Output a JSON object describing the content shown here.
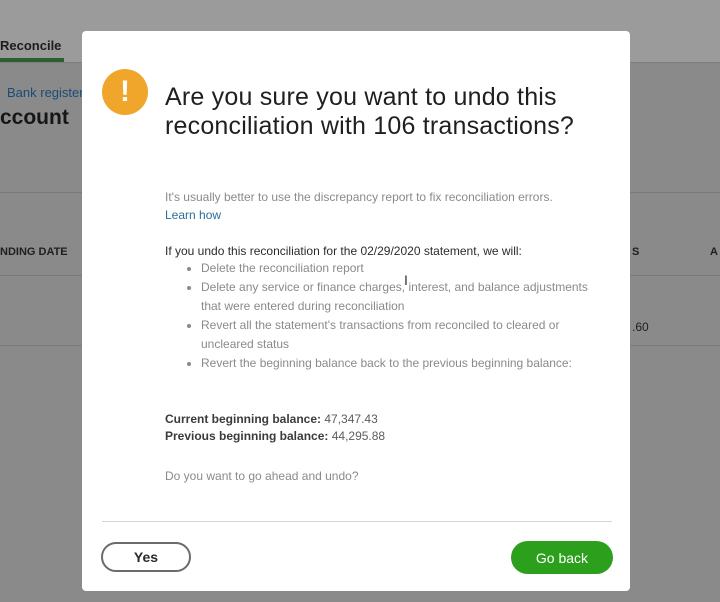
{
  "background": {
    "tab_label": "Reconcile",
    "breadcrumb": "Bank register",
    "heading": "ccount",
    "column_ending_date": "NDING DATE",
    "column_s": "S",
    "column_a": "A",
    "row_value": ".60"
  },
  "dialog": {
    "title": "Are you sure you want to undo this reconciliation with 106 transactions?",
    "note": "It's usually better to use the discrepancy report to fix reconciliation errors.",
    "learn_how": "Learn how",
    "lead": "If you undo this reconciliation for the 02/29/2020 statement, we will:",
    "bullets": [
      "Delete the reconciliation report",
      "Delete any service or finance charges, interest, and balance adjustments that were entered during reconciliation",
      "Revert all the statement's transactions from reconciled to cleared or uncleared status",
      "Revert the beginning balance back to the previous beginning balance:"
    ],
    "current_label": "Current beginning balance:",
    "current_value": "47,347.43",
    "previous_label": "Previous beginning balance:",
    "previous_value": "44,295.88",
    "question": "Do you want to go ahead and undo?",
    "yes_label": "Yes",
    "go_back_label": "Go back",
    "warning_glyph": "!"
  },
  "icons": {
    "warning": "warning-icon",
    "cursor": "text-cursor-icon"
  },
  "colors": {
    "primary_button": "#2ca01c",
    "warning": "#efa62a",
    "link": "#2a6f9e"
  }
}
